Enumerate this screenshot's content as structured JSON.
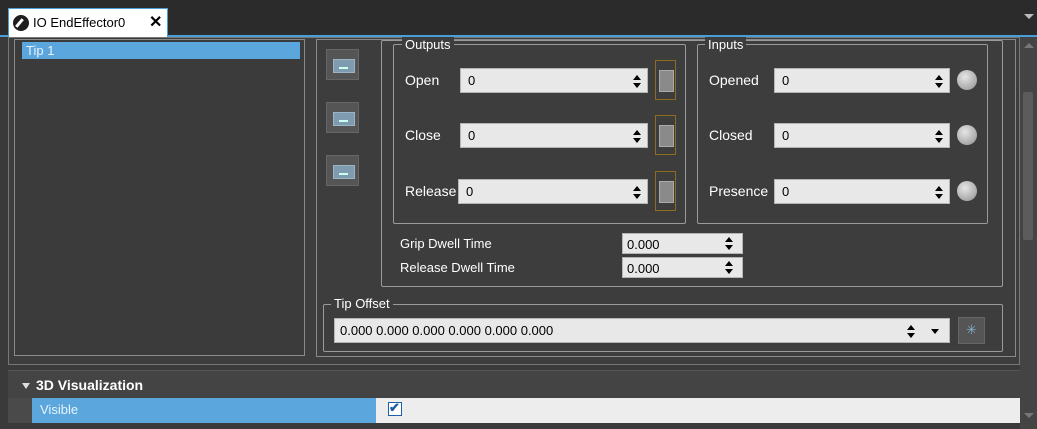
{
  "tab": {
    "title": "IO EndEffector0",
    "close": "✕"
  },
  "tips": [
    {
      "label": "Tip 1"
    }
  ],
  "outputs": {
    "legend": "Outputs",
    "rows": [
      {
        "label": "Open",
        "value": "0"
      },
      {
        "label": "Close",
        "value": "0"
      },
      {
        "label": "Release",
        "value": "0"
      }
    ]
  },
  "inputs": {
    "legend": "Inputs",
    "rows": [
      {
        "label": "Opened",
        "value": "0"
      },
      {
        "label": "Closed",
        "value": "0"
      },
      {
        "label": "Presence",
        "value": "0"
      }
    ]
  },
  "dwell": {
    "grip_label": "Grip Dwell Time",
    "grip_value": "0.000",
    "release_label": "Release Dwell Time",
    "release_value": "0.000"
  },
  "tip_offset": {
    "legend": "Tip Offset",
    "value": "0.000 0.000 0.000 0.000 0.000 0.000"
  },
  "properties": {
    "section_title": "3D Visualization",
    "rows": [
      {
        "name": "Visible",
        "checked": true
      }
    ]
  },
  "colors": {
    "accent": "#4a9ed8",
    "selection": "#5ba6dc",
    "panel": "#3d3d3d"
  }
}
